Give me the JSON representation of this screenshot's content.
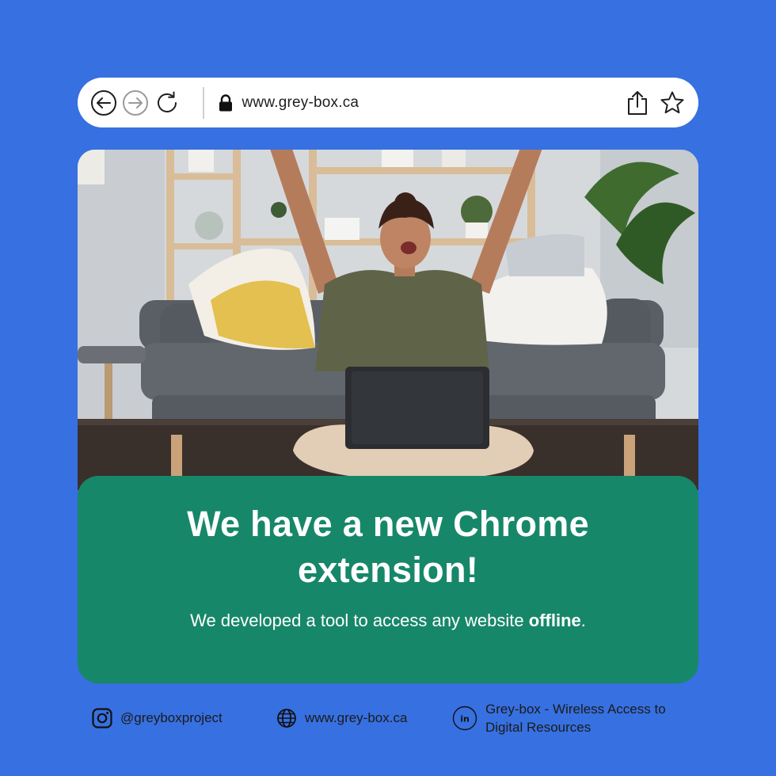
{
  "browser": {
    "url": "www.grey-box.ca",
    "icons": [
      "back-arrow-icon",
      "forward-arrow-icon",
      "reload-icon",
      "lock-icon",
      "share-icon",
      "star-icon"
    ]
  },
  "hero": {
    "image": "woman-celebrating-laptop-photo"
  },
  "card": {
    "headline": "We have a new Chrome extension!",
    "subtext_before": "We developed a tool to access any website ",
    "subtext_bold": "offline",
    "subtext_after": "."
  },
  "footer": {
    "instagram": "@greyboxproject",
    "website": "www.grey-box.ca",
    "linkedin_line1": "Grey-box - Wireless Access to",
    "linkedin_line2": "Digital Resources"
  },
  "colors": {
    "background": "#3770e0",
    "card": "#178769",
    "bar": "#ffffff"
  }
}
